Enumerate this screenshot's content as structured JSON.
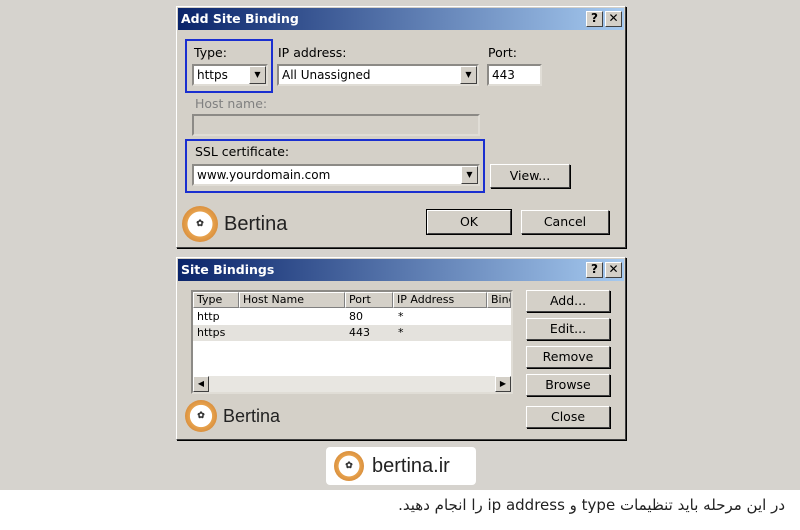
{
  "add_binding": {
    "title": "Add Site Binding",
    "help_btn": "?",
    "close_btn": "✕",
    "type_label": "Type:",
    "type_value": "https",
    "ip_label": "IP address:",
    "ip_value": "All Unassigned",
    "port_label": "Port:",
    "port_value": "443",
    "host_label": "Host name:",
    "host_value": "",
    "ssl_label": "SSL certificate:",
    "ssl_value": "www.yourdomain.com",
    "view_btn": "View...",
    "ok_btn": "OK",
    "cancel_btn": "Cancel",
    "logo_text": "Bertina"
  },
  "site_bindings": {
    "title": "Site Bindings",
    "help_btn": "?",
    "close_btn": "✕",
    "columns": [
      "Type",
      "Host Name",
      "Port",
      "IP Address",
      "Bind"
    ],
    "rows": [
      {
        "type": "http",
        "host": "",
        "port": "80",
        "ip": "*"
      },
      {
        "type": "https",
        "host": "",
        "port": "443",
        "ip": "*"
      }
    ],
    "add_btn": "Add...",
    "edit_btn": "Edit...",
    "remove_btn": "Remove",
    "browse_btn": "Browse",
    "close_label": "Close",
    "logo_text": "Bertina"
  },
  "footer": {
    "site": "bertina.ir",
    "caption": "در این مرحله باید تنظیمات type و ip address را انجام دهید."
  }
}
